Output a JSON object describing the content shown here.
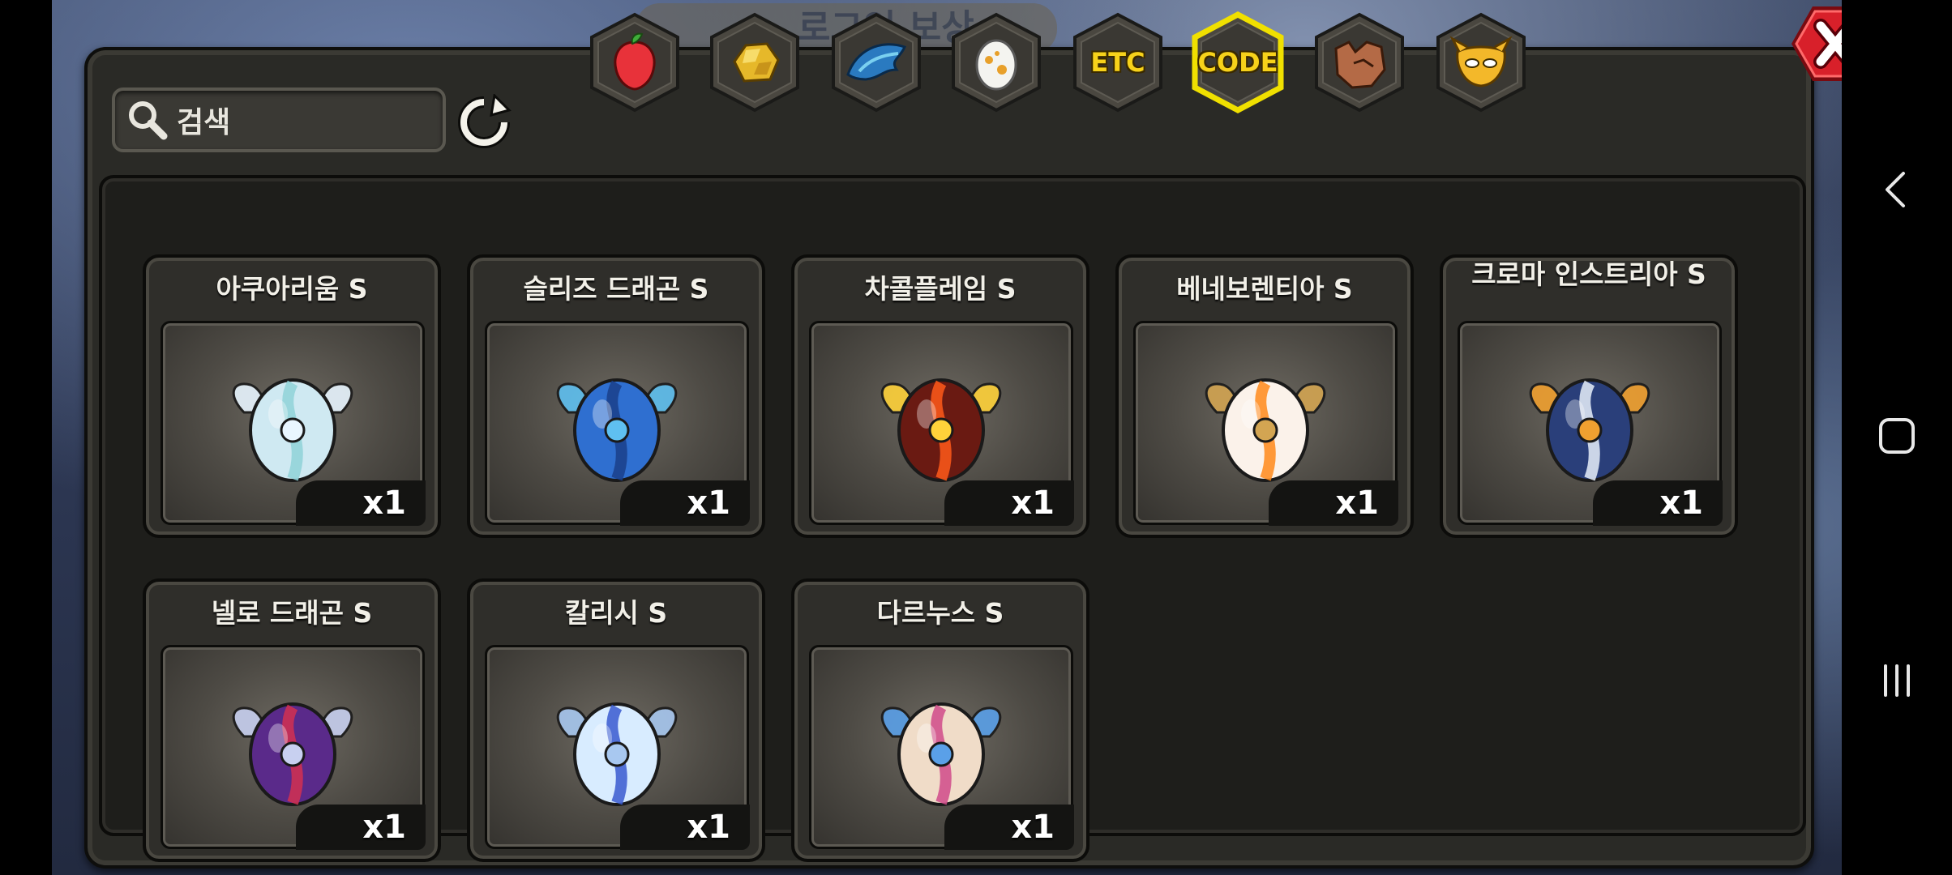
{
  "behind_banner": "로그인 보상",
  "search": {
    "placeholder": "검색"
  },
  "tabs": [
    {
      "id": "fruit",
      "icon": "fruit-icon",
      "label": "",
      "selected": false
    },
    {
      "id": "gold",
      "icon": "gold-ore-icon",
      "label": "",
      "selected": false
    },
    {
      "id": "dragon",
      "icon": "dragon-scale-icon",
      "label": "",
      "selected": false
    },
    {
      "id": "egg",
      "icon": "egg-icon",
      "label": "",
      "selected": false
    },
    {
      "id": "etc",
      "icon": "",
      "label": "ETC",
      "selected": false
    },
    {
      "id": "code",
      "icon": "",
      "label": "CODE",
      "selected": true
    },
    {
      "id": "beast",
      "icon": "wolf-head-icon",
      "label": "",
      "selected": false
    },
    {
      "id": "mask",
      "icon": "mask-icon",
      "label": "",
      "selected": false
    }
  ],
  "items": [
    {
      "name": "아쿠아리움 S",
      "count": "x1",
      "egg": "aquarium-egg-icon",
      "colors": [
        "#cfe9f2",
        "#8fd2d8",
        "#e9f6ff"
      ]
    },
    {
      "name": "슬리즈 드래곤 S",
      "count": "x1",
      "egg": "sleaze-dragon-egg-icon",
      "colors": [
        "#2f6fd0",
        "#1a3f8a",
        "#5fc0f0"
      ]
    },
    {
      "name": "차콜플레임  S",
      "count": "x1",
      "egg": "charcoal-flame-egg-icon",
      "colors": [
        "#6a1a12",
        "#ff5a1a",
        "#ffd23a"
      ]
    },
    {
      "name": "베네보렌티아 S",
      "count": "x1",
      "egg": "benevolentia-egg-icon",
      "colors": [
        "#fbf2ea",
        "#ff8a1a",
        "#d3a552"
      ]
    },
    {
      "name": "크로마 인스트리아 S",
      "count": "x1",
      "egg": "chroma-instria-egg-icon",
      "colors": [
        "#2a3f7a",
        "#e8f0fa",
        "#f0a030"
      ]
    },
    {
      "name": "넬로 드래곤 S",
      "count": "x1",
      "egg": "nello-dragon-egg-icon",
      "colors": [
        "#5a2a8a",
        "#d43050",
        "#c8d0f0"
      ]
    },
    {
      "name": "칼리시 S",
      "count": "x1",
      "egg": "calici-egg-icon",
      "colors": [
        "#d8ecff",
        "#3a5ad0",
        "#a8c8f0"
      ]
    },
    {
      "name": "다르누스 S",
      "count": "x1",
      "egg": "darnus-egg-icon",
      "colors": [
        "#f0dcc8",
        "#d04a8a",
        "#5aa0e8"
      ]
    }
  ],
  "icons": {
    "search": "search-icon",
    "refresh": "refresh-icon",
    "close": "close-icon",
    "nav_back": "back-chevron-icon",
    "nav_home": "home-square-icon",
    "nav_recent": "recent-apps-icon"
  },
  "colors": {
    "accent_selected_tab": "#f0e000",
    "close_red": "#d8202a"
  }
}
